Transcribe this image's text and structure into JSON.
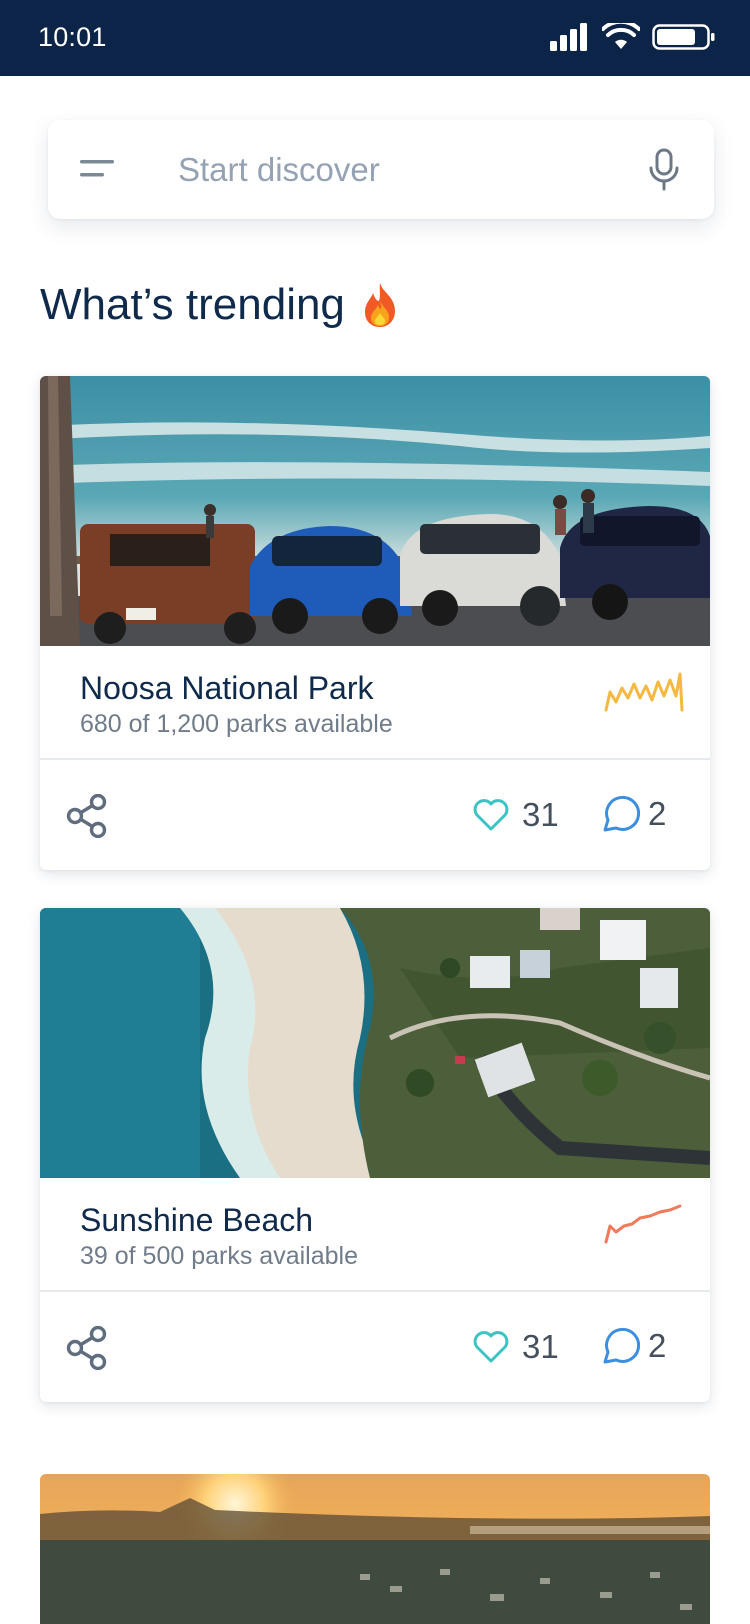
{
  "status_bar": {
    "time": "10:01",
    "icons": [
      "signal-icon",
      "wifi-icon",
      "battery-icon"
    ]
  },
  "search": {
    "placeholder": "Start discover",
    "icons": [
      "menu-icon",
      "mic-icon"
    ]
  },
  "section": {
    "title": "What’s trending",
    "emoji_icon": "fire-icon"
  },
  "cards": [
    {
      "title": "Noosa National Park",
      "subtitle": "680 of 1,200 parks available",
      "likes": "31",
      "comments": "2",
      "trend_color": "#f5b942",
      "image": "beach-carpark-photo"
    },
    {
      "title": "Sunshine Beach",
      "subtitle": "39 of 500 parks available",
      "likes": "31",
      "comments": "2",
      "trend_color": "#f07a5a",
      "image": "aerial-beach-photo"
    }
  ],
  "partial_card": {
    "image": "sunset-town-photo"
  },
  "colors": {
    "navy": "#0c2447",
    "heart": "#3cc3c4",
    "comment": "#3c8ede",
    "icon_grey": "#5f6d7e"
  }
}
